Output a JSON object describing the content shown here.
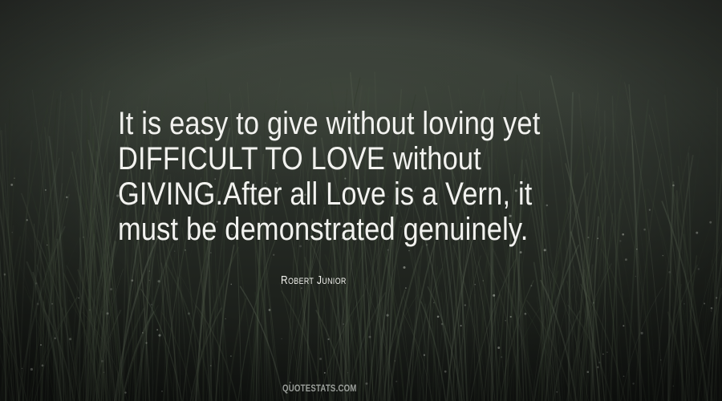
{
  "quote": {
    "lines": [
      "It is easy to give without loving yet",
      "DIFFICULT TO LOVE without",
      "GIVING.After all Love is a Vern, it",
      "must be demonstrated genuinely."
    ]
  },
  "author": "Robert Junior",
  "watermark": "QUOTESTATS.COM",
  "colors": {
    "text": "#f2f2ef",
    "background_top": "#3b403a",
    "background_bottom": "#141714",
    "grass": "#4a5446"
  }
}
